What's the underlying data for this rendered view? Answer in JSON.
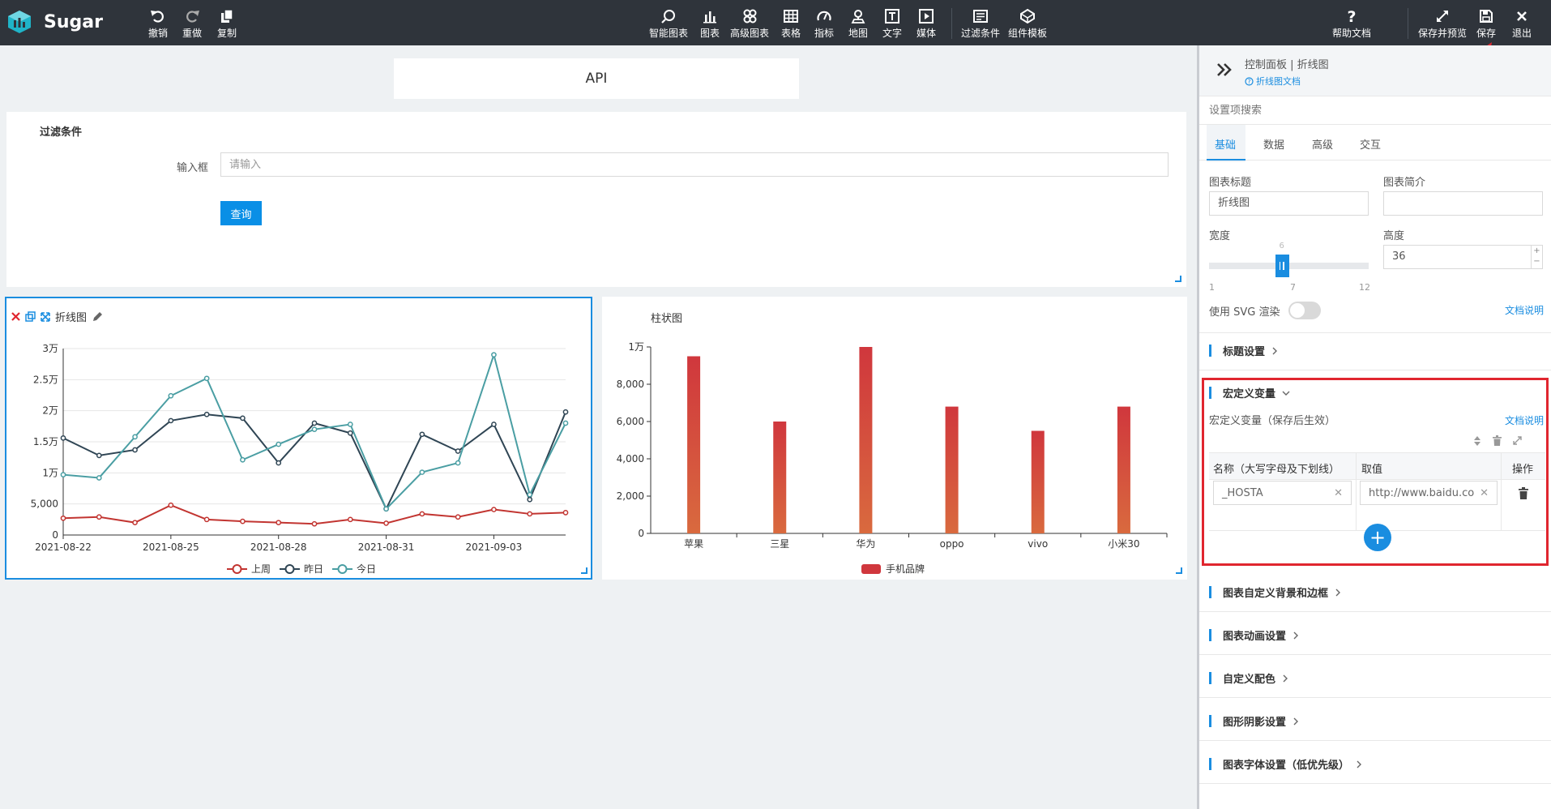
{
  "app": {
    "logo_text": "Sugar"
  },
  "toolbar": {
    "undo": "撤销",
    "redo": "重做",
    "copy": "复制",
    "smart_chart": "智能图表",
    "chart": "图表",
    "advanced_chart": "高级图表",
    "table": "表格",
    "metric": "指标",
    "map": "地图",
    "text": "文字",
    "media": "媒体",
    "filter": "过滤条件",
    "component_template": "组件模板",
    "help_doc": "帮助文档",
    "save_preview": "保存并预览",
    "save": "保存",
    "exit": "退出"
  },
  "canvas": {
    "api_title": "API",
    "filter": {
      "title": "过滤条件",
      "input_label": "输入框",
      "input_placeholder": "请输入",
      "query_button": "查询"
    }
  },
  "line_chart_card": {
    "title": "折线图"
  },
  "bar_chart_card": {
    "title": "柱状图"
  },
  "chart_data": [
    {
      "type": "line",
      "title": "折线图",
      "x": [
        "2021-08-22",
        "2021-08-23",
        "2021-08-24",
        "2021-08-25",
        "2021-08-26",
        "2021-08-27",
        "2021-08-28",
        "2021-08-29",
        "2021-08-30",
        "2021-08-31",
        "2021-09-01",
        "2021-09-02",
        "2021-09-03",
        "2021-09-04",
        "2021-09-05"
      ],
      "x_tick_labels": [
        "2021-08-22",
        "2021-08-25",
        "2021-08-28",
        "2021-08-31",
        "2021-09-03"
      ],
      "y_tick_labels": [
        "0",
        "5,000",
        "1万",
        "1.5万",
        "2万",
        "2.5万",
        "3万"
      ],
      "ylim": [
        0,
        30000
      ],
      "grid": true,
      "legend": "bottom",
      "series": [
        {
          "name": "上周",
          "color": "#c23531",
          "values": [
            2700,
            2900,
            2000,
            4800,
            2500,
            2200,
            2000,
            1800,
            2500,
            1900,
            3400,
            2900,
            4100,
            3400,
            3600
          ]
        },
        {
          "name": "昨日",
          "color": "#2f4554",
          "values": [
            15600,
            12800,
            13700,
            18400,
            19400,
            18800,
            11600,
            18000,
            16400,
            4200,
            16200,
            13500,
            17800,
            5700,
            19800
          ]
        },
        {
          "name": "今日",
          "color": "#4a9ea3",
          "values": [
            9700,
            9200,
            15800,
            22400,
            25200,
            12100,
            14600,
            17000,
            17800,
            4200,
            10100,
            11600,
            29000,
            6500,
            18000
          ]
        }
      ]
    },
    {
      "type": "bar",
      "title": "柱状图",
      "categories": [
        "苹果",
        "三星",
        "华为",
        "oppo",
        "vivo",
        "小米30"
      ],
      "y_tick_labels": [
        "0",
        "2,000",
        "4,000",
        "6,000",
        "8,000",
        "1万"
      ],
      "ylim": [
        0,
        10000
      ],
      "legend": "bottom",
      "series": [
        {
          "name": "手机品牌",
          "color": "#d0373d",
          "values": [
            9500,
            6000,
            10000,
            6800,
            5500,
            6800
          ]
        }
      ]
    }
  ],
  "panel": {
    "breadcrumb": "控制面板 | 折线图",
    "doc_link": "折线图文档",
    "search_placeholder": "设置项搜索",
    "tabs": [
      "基础",
      "数据",
      "高级",
      "交互"
    ],
    "chart_title_label": "图表标题",
    "chart_title_value": "折线图",
    "chart_desc_label": "图表简介",
    "width_label": "宽度",
    "width_value": "6",
    "width_min": "1",
    "width_mid": "7",
    "width_max": "12",
    "width_fraction": 0.4545,
    "height_label": "高度",
    "height_value": "36",
    "svg_render_label": "使用 SVG 渲染",
    "svg_doc_link": "文档说明",
    "sections": {
      "title_settings": "标题设置",
      "macro": "宏定义变量",
      "bg_border": "图表自定义背景和边框",
      "animation": "图表动画设置",
      "colors": "自定义配色",
      "shadow": "图形阴影设置",
      "font": "图表字体设置（低优先级）"
    },
    "macro": {
      "subtitle": "宏定义变量（保存后生效）",
      "doc_link": "文档说明",
      "col_name": "名称（大写字母及下划线）",
      "col_value": "取值",
      "col_op": "操作",
      "row_name": "_HOSTA",
      "row_value": "http://www.baidu.co"
    }
  }
}
